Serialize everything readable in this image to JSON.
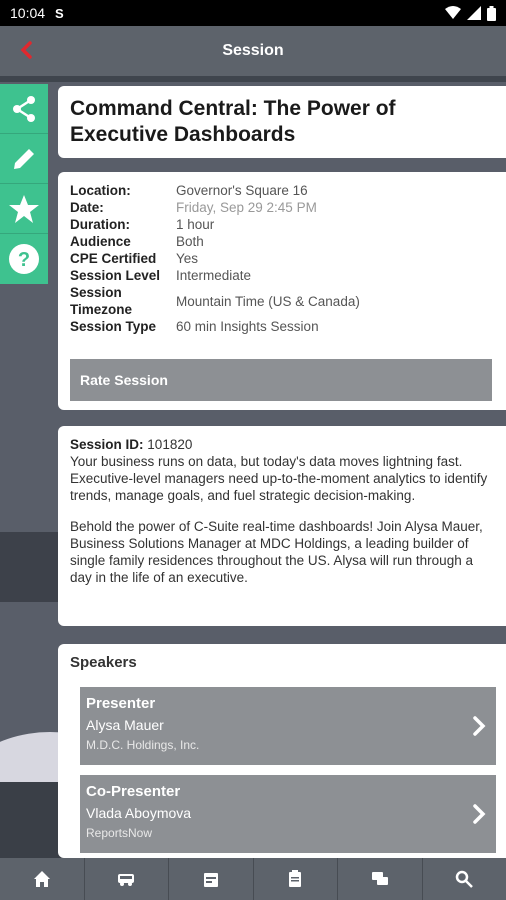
{
  "status": {
    "time": "10:04",
    "app_icon": "S"
  },
  "header": {
    "title": "Session"
  },
  "session": {
    "title": "Command Central: The Power of Executive Dashboards",
    "details": [
      {
        "label": "Location:",
        "value": "Governor's Square 16"
      },
      {
        "label": "Date:",
        "value": "Friday, Sep 29 2:45 PM"
      },
      {
        "label": "Duration:",
        "value": "1 hour"
      },
      {
        "label": "Audience",
        "value": "Both"
      },
      {
        "label": "CPE Certified",
        "value": "Yes"
      },
      {
        "label": "Session Level",
        "value": "Intermediate"
      },
      {
        "label": "Session Timezone",
        "value": "Mountain Time (US & Canada)"
      },
      {
        "label": "Session Type",
        "value": "60 min Insights Session"
      }
    ],
    "rate_label": "Rate Session",
    "id_label": "Session ID:",
    "id_value": "101820",
    "description_1": "Your business runs on data, but today's data moves lightning fast. Executive-level managers need up-to-the-moment analytics to identify trends, manage goals, and fuel strategic decision-making.",
    "description_2": "Behold the power of C-Suite real-time dashboards! Join Alysa Mauer, Business Solutions Manager at MDC Holdings, a leading builder of single family residences throughout the US. Alysa will run through a day in the life of an executive."
  },
  "speakers": {
    "heading": "Speakers",
    "items": [
      {
        "role": "Presenter",
        "name": "Alysa Mauer",
        "org": "M.D.C. Holdings, Inc."
      },
      {
        "role": "Co-Presenter",
        "name": "Vlada Aboymova",
        "org": "ReportsNow"
      }
    ]
  },
  "colors": {
    "accent": "#3ec28f",
    "back": "#e0282e",
    "header": "#5d636b"
  },
  "nav": [
    "home-icon",
    "bus-icon",
    "schedule-icon",
    "clipboard-icon",
    "chat-icon",
    "search-icon"
  ]
}
